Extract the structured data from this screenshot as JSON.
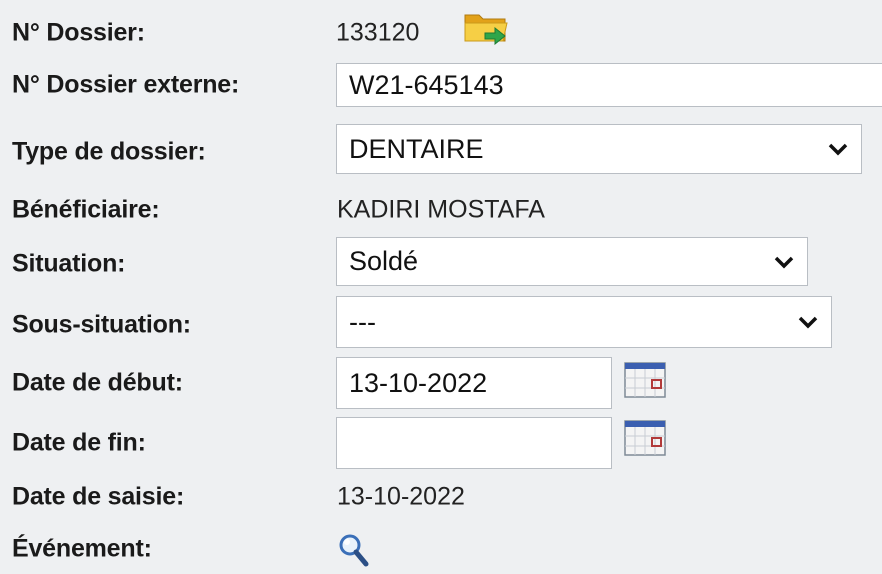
{
  "fields": {
    "dossier_no": {
      "label": "N° Dossier:",
      "value": "133120"
    },
    "dossier_externe": {
      "label": "N° Dossier externe:",
      "value": "W21-645143"
    },
    "type_dossier": {
      "label": "Type de dossier:",
      "selected": "DENTAIRE"
    },
    "beneficiaire": {
      "label": "Bénéficiaire:",
      "value": "KADIRI MOSTAFA"
    },
    "situation": {
      "label": "Situation:",
      "selected": "Soldé"
    },
    "sous_situation": {
      "label": "Sous-situation:",
      "selected": "---"
    },
    "date_debut": {
      "label": "Date de début:",
      "value": "13-10-2022"
    },
    "date_fin": {
      "label": "Date de fin:",
      "value": ""
    },
    "date_saisie": {
      "label": "Date de saisie:",
      "value": "13-10-2022"
    },
    "evenement": {
      "label": "Événement:"
    }
  },
  "icons": {
    "folder": "folder-open-icon",
    "calendar": "calendar-icon",
    "search": "magnifier-icon",
    "dropdown": "chevron-down-icon"
  },
  "colors": {
    "background": "#eef0f2",
    "folder": "#f2c230",
    "arrow": "#2fa64a",
    "calendar_header": "#3b5fb0",
    "calendar_mark": "#b23a3a"
  }
}
